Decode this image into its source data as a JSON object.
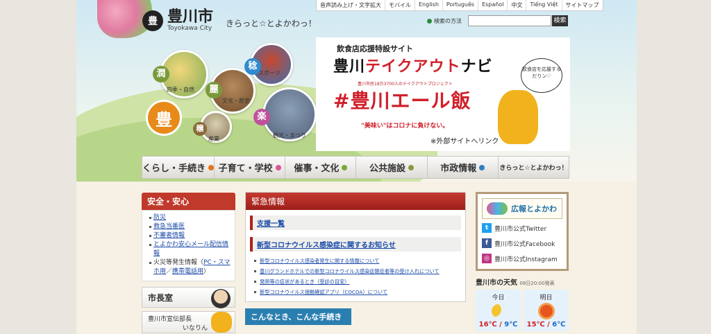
{
  "header": {
    "logo_mark": "豊",
    "site_name": "豊川市",
    "romaji": "Toyokawa City",
    "tagline": "きらっと☆とよかわっ！"
  },
  "utility_links": [
    "音声読み上げ・文字拡大",
    "モバイル",
    "English",
    "Português",
    "Español",
    "中文",
    "Tiếng Việt",
    "サイトマップ"
  ],
  "search": {
    "label": "検索の方法",
    "placeholder": "",
    "button": "検索"
  },
  "hero": {
    "big_badge": "豊",
    "items": [
      {
        "badge": "潤",
        "label": "四季・自然",
        "color": "#7a9a3a"
      },
      {
        "badge": "稔",
        "label": "スポーツ",
        "color": "#2f8bcf"
      },
      {
        "badge": "麗",
        "label": "文化・歴史",
        "color": "#7a9a3a"
      },
      {
        "badge": "楽",
        "label": "観光・まつり",
        "color": "#c0509b"
      },
      {
        "badge": "穣",
        "label": "産業",
        "color": "#8a6a3a"
      }
    ]
  },
  "banner": {
    "top": "飲食店応援特設サイト",
    "title_black": "豊川",
    "title_red": "テイクアウト",
    "title_black2": "ナビ",
    "sub": "豊川市民18万3700人のテイクアウトプロジェクト",
    "hashtag": "#豊川エール飯",
    "tag": "\"美味い\"はコロナに負けない。",
    "bubble": "飲食店を応援するだりン♡",
    "note": "※外部サイトへリンク"
  },
  "global_nav": [
    {
      "label": "くらし・手続き",
      "color": "#e8731a"
    },
    {
      "label": "子育て・学校",
      "color": "#d9559a"
    },
    {
      "label": "催事・文化",
      "color": "#7aa83a"
    },
    {
      "label": "公共施設",
      "color": "#8a9a3a"
    },
    {
      "label": "市政情報",
      "color": "#2f7fc0"
    },
    {
      "label": "きらっと☆とよかわっ！",
      "color": "#e8731a"
    }
  ],
  "safety": {
    "title": "安全・安心",
    "items": [
      {
        "text": "防災",
        "link": true
      },
      {
        "text": "救急当番医",
        "link": true
      },
      {
        "text": "不審者情報",
        "link": true
      },
      {
        "text": "とよかわ安心メール配信情報",
        "link": true
      }
    ],
    "fire_prefix": "火災等発生情報（",
    "fire_pc": "PC・スマホ用",
    "fire_sep": "／",
    "fire_mobile": "携帯電話用",
    "fire_suffix": "）"
  },
  "mayor": {
    "label": "市長室"
  },
  "pr_chief": {
    "line1": "豊川市宣伝部長",
    "line2": "いなりん"
  },
  "emergency": {
    "title": "緊急情報",
    "support": "支援一覧",
    "corona_head": "新型コロナウイルス感染症に関するお知らせ",
    "items": [
      "新型コロナウイルス感染者発生に関する情報について",
      "豊川グランドホテルでの新型コロナウイルス感染症軽症者等の受け入れについて",
      "発熱等の症状があるとき（受診の目安）",
      "新型コロナウイルス接触確認アプリ（COCOA）について"
    ]
  },
  "procedures": {
    "title": "こんなとき、こんな手続き"
  },
  "pr_box": {
    "title": "広報とよかわ",
    "sns": [
      {
        "label": "豊川市公式Twitter",
        "icon": "twitter-icon",
        "glyph": "t",
        "color": "#1da1f2"
      },
      {
        "label": "豊川市公式Facebook",
        "icon": "facebook-icon",
        "glyph": "f",
        "color": "#3b5998"
      },
      {
        "label": "豊川市公式Instagram",
        "icon": "instagram-icon",
        "glyph": "◎",
        "color": "#c13584"
      }
    ]
  },
  "weather": {
    "title": "豊川市の天気",
    "time": "08日20:00発表",
    "today": {
      "label": "今日",
      "high": "16℃",
      "low": "9℃"
    },
    "tomorrow": {
      "label": "明日",
      "high": "15℃",
      "low": "6℃"
    },
    "sep": " / "
  }
}
